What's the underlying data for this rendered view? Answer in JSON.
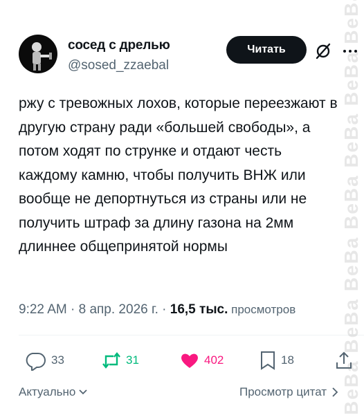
{
  "author": {
    "name": "сосед с дрелью",
    "handle": "@sosed_zzaebal"
  },
  "header": {
    "follow_label": "Читать",
    "icons": [
      "grok-icon",
      "more-icon"
    ]
  },
  "tweet": {
    "text": "ржу с тревожных лохов, которые переезжают в другую страну ради «большей свободы», а потом ходят по струнке и отдают честь каждому камню, чтобы получить ВНЖ или вообще не депортнуться из страны или не получить штраф за длину газона на 2мм длиннее общепринятой нормы"
  },
  "meta": {
    "time": "9:22 AM",
    "sep1": " · ",
    "date": "8 апр. 2026 г.",
    "sep2": " · ",
    "views_count": "16,5 тыс.",
    "views_label": " просмотров"
  },
  "actions": {
    "replies": "33",
    "retweets": "31",
    "likes": "402",
    "bookmarks": "18"
  },
  "footer": {
    "sort_label": "Актуально",
    "quotes_label": "Просмотр цитат"
  },
  "colors": {
    "text": "#0f1419",
    "secondary": "#536471",
    "retweet": "#00ba7c",
    "like": "#f91880",
    "button": "#0f1419"
  }
}
